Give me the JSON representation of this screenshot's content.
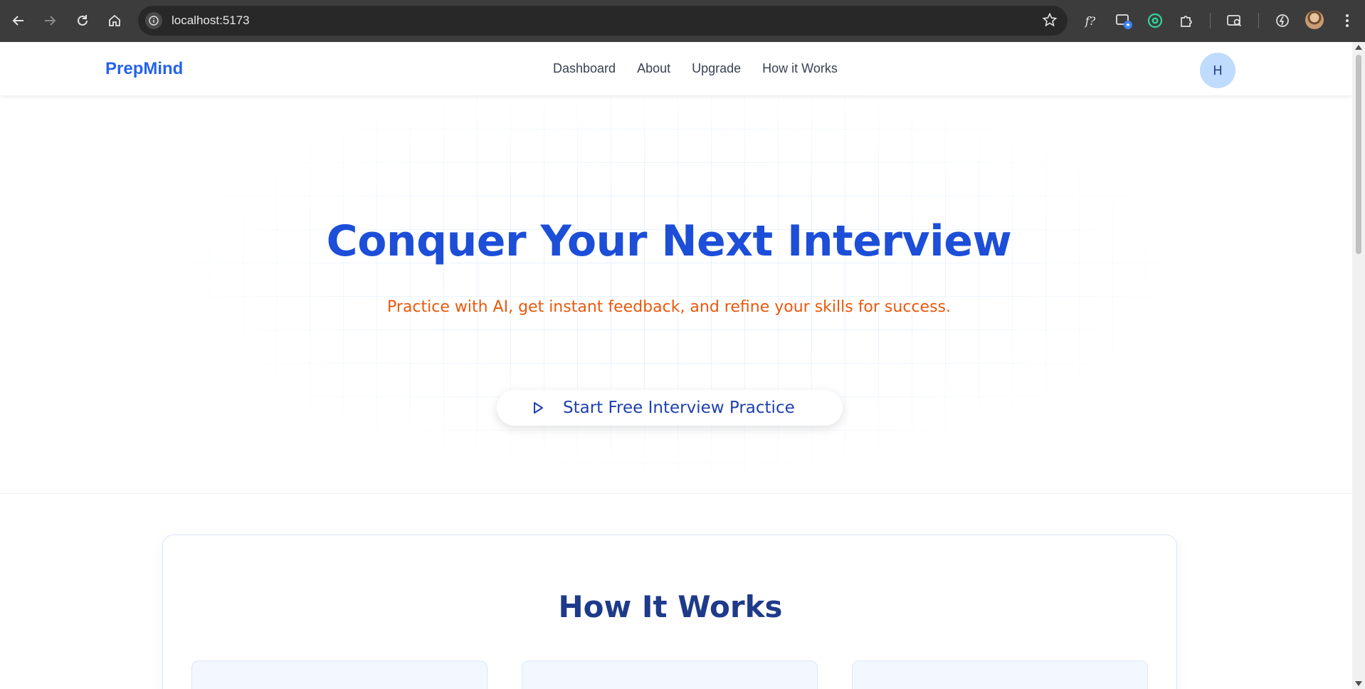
{
  "browser": {
    "url": "localhost:5173",
    "extensions": [
      "formula-icon",
      "picture-in-picture-icon",
      "target-extension-icon",
      "puzzle-extensions-icon",
      "tab-search-icon",
      "performance-icon"
    ]
  },
  "header": {
    "logo": "PrepMind",
    "nav": [
      "Dashboard",
      "About",
      "Upgrade",
      "How it Works"
    ],
    "user_initial": "H"
  },
  "hero": {
    "title": "Conquer Your Next Interview",
    "subtitle": "Practice with AI, get instant feedback, and refine your skills for success.",
    "cta_label": "Start Free Interview Practice",
    "title_color": "#1d4ed8",
    "subtitle_color": "#ea580c"
  },
  "how_it_works": {
    "title": "How It Works",
    "steps": [
      {},
      {},
      {}
    ]
  }
}
